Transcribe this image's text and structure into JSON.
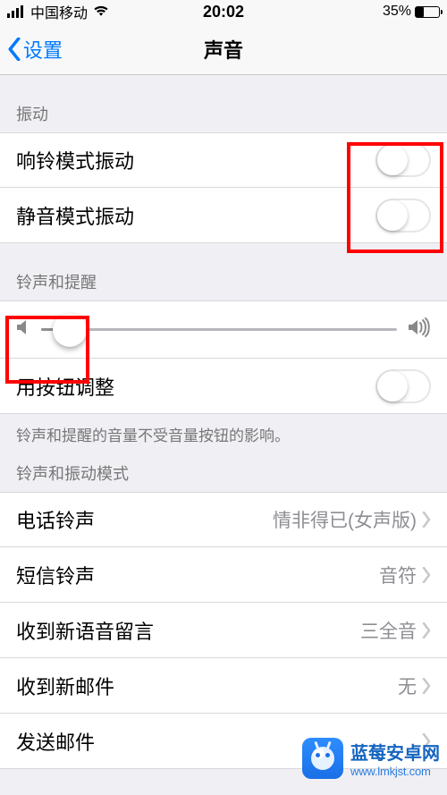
{
  "status": {
    "carrier": "中国移动",
    "time": "20:02",
    "battery_pct": "35%"
  },
  "nav": {
    "back_label": "设置",
    "title": "声音"
  },
  "sections": {
    "vibration": {
      "header": "振动",
      "ring_vibrate": "响铃模式振动",
      "silent_vibrate": "静音模式振动"
    },
    "ringer": {
      "header": "铃声和提醒",
      "button_change": "用按钮调整",
      "footer": "铃声和提醒的音量不受音量按钮的影响。"
    },
    "sounds": {
      "header": "铃声和振动模式",
      "ringtone_label": "电话铃声",
      "ringtone_value": "情非得已(女声版)",
      "text_tone_label": "短信铃声",
      "text_tone_value": "音符",
      "voicemail_label": "收到新语音留言",
      "voicemail_value": "三全音",
      "mail_label": "收到新邮件",
      "mail_value": "无",
      "sent_mail_label": "发送邮件"
    }
  },
  "watermark": {
    "title": "蓝莓安卓网",
    "url": "www.lmkjst.com"
  }
}
